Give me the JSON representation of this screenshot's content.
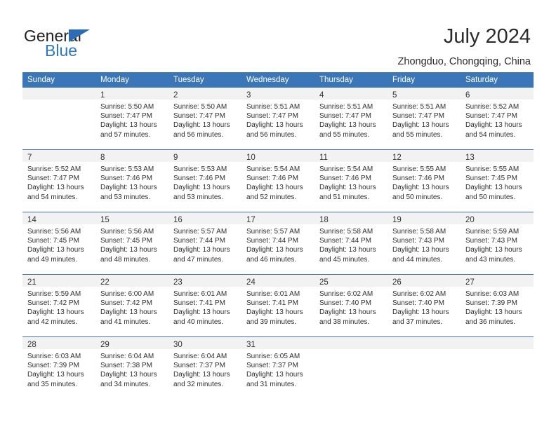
{
  "brand": {
    "name_part1": "General",
    "name_part2": "Blue",
    "triangle_color": "#2b6cb3",
    "blue_color": "#2b79c2"
  },
  "header": {
    "title": "July 2024",
    "subtitle": "Zhongduo, Chongqing, China",
    "accent_color": "#3a76b8"
  },
  "weekdays": [
    "Sunday",
    "Monday",
    "Tuesday",
    "Wednesday",
    "Thursday",
    "Friday",
    "Saturday"
  ],
  "labels": {
    "sunrise_prefix": "Sunrise: ",
    "sunset_prefix": "Sunset: ",
    "daylight_prefix": "Daylight: "
  },
  "weeks": [
    [
      {
        "day": "",
        "sunrise": "",
        "sunset": "",
        "daylight_line1": "",
        "daylight_line2": ""
      },
      {
        "day": "1",
        "sunrise": "Sunrise: 5:50 AM",
        "sunset": "Sunset: 7:47 PM",
        "daylight_line1": "Daylight: 13 hours",
        "daylight_line2": "and 57 minutes."
      },
      {
        "day": "2",
        "sunrise": "Sunrise: 5:50 AM",
        "sunset": "Sunset: 7:47 PM",
        "daylight_line1": "Daylight: 13 hours",
        "daylight_line2": "and 56 minutes."
      },
      {
        "day": "3",
        "sunrise": "Sunrise: 5:51 AM",
        "sunset": "Sunset: 7:47 PM",
        "daylight_line1": "Daylight: 13 hours",
        "daylight_line2": "and 56 minutes."
      },
      {
        "day": "4",
        "sunrise": "Sunrise: 5:51 AM",
        "sunset": "Sunset: 7:47 PM",
        "daylight_line1": "Daylight: 13 hours",
        "daylight_line2": "and 55 minutes."
      },
      {
        "day": "5",
        "sunrise": "Sunrise: 5:51 AM",
        "sunset": "Sunset: 7:47 PM",
        "daylight_line1": "Daylight: 13 hours",
        "daylight_line2": "and 55 minutes."
      },
      {
        "day": "6",
        "sunrise": "Sunrise: 5:52 AM",
        "sunset": "Sunset: 7:47 PM",
        "daylight_line1": "Daylight: 13 hours",
        "daylight_line2": "and 54 minutes."
      }
    ],
    [
      {
        "day": "7",
        "sunrise": "Sunrise: 5:52 AM",
        "sunset": "Sunset: 7:47 PM",
        "daylight_line1": "Daylight: 13 hours",
        "daylight_line2": "and 54 minutes."
      },
      {
        "day": "8",
        "sunrise": "Sunrise: 5:53 AM",
        "sunset": "Sunset: 7:46 PM",
        "daylight_line1": "Daylight: 13 hours",
        "daylight_line2": "and 53 minutes."
      },
      {
        "day": "9",
        "sunrise": "Sunrise: 5:53 AM",
        "sunset": "Sunset: 7:46 PM",
        "daylight_line1": "Daylight: 13 hours",
        "daylight_line2": "and 53 minutes."
      },
      {
        "day": "10",
        "sunrise": "Sunrise: 5:54 AM",
        "sunset": "Sunset: 7:46 PM",
        "daylight_line1": "Daylight: 13 hours",
        "daylight_line2": "and 52 minutes."
      },
      {
        "day": "11",
        "sunrise": "Sunrise: 5:54 AM",
        "sunset": "Sunset: 7:46 PM",
        "daylight_line1": "Daylight: 13 hours",
        "daylight_line2": "and 51 minutes."
      },
      {
        "day": "12",
        "sunrise": "Sunrise: 5:55 AM",
        "sunset": "Sunset: 7:46 PM",
        "daylight_line1": "Daylight: 13 hours",
        "daylight_line2": "and 50 minutes."
      },
      {
        "day": "13",
        "sunrise": "Sunrise: 5:55 AM",
        "sunset": "Sunset: 7:45 PM",
        "daylight_line1": "Daylight: 13 hours",
        "daylight_line2": "and 50 minutes."
      }
    ],
    [
      {
        "day": "14",
        "sunrise": "Sunrise: 5:56 AM",
        "sunset": "Sunset: 7:45 PM",
        "daylight_line1": "Daylight: 13 hours",
        "daylight_line2": "and 49 minutes."
      },
      {
        "day": "15",
        "sunrise": "Sunrise: 5:56 AM",
        "sunset": "Sunset: 7:45 PM",
        "daylight_line1": "Daylight: 13 hours",
        "daylight_line2": "and 48 minutes."
      },
      {
        "day": "16",
        "sunrise": "Sunrise: 5:57 AM",
        "sunset": "Sunset: 7:44 PM",
        "daylight_line1": "Daylight: 13 hours",
        "daylight_line2": "and 47 minutes."
      },
      {
        "day": "17",
        "sunrise": "Sunrise: 5:57 AM",
        "sunset": "Sunset: 7:44 PM",
        "daylight_line1": "Daylight: 13 hours",
        "daylight_line2": "and 46 minutes."
      },
      {
        "day": "18",
        "sunrise": "Sunrise: 5:58 AM",
        "sunset": "Sunset: 7:44 PM",
        "daylight_line1": "Daylight: 13 hours",
        "daylight_line2": "and 45 minutes."
      },
      {
        "day": "19",
        "sunrise": "Sunrise: 5:58 AM",
        "sunset": "Sunset: 7:43 PM",
        "daylight_line1": "Daylight: 13 hours",
        "daylight_line2": "and 44 minutes."
      },
      {
        "day": "20",
        "sunrise": "Sunrise: 5:59 AM",
        "sunset": "Sunset: 7:43 PM",
        "daylight_line1": "Daylight: 13 hours",
        "daylight_line2": "and 43 minutes."
      }
    ],
    [
      {
        "day": "21",
        "sunrise": "Sunrise: 5:59 AM",
        "sunset": "Sunset: 7:42 PM",
        "daylight_line1": "Daylight: 13 hours",
        "daylight_line2": "and 42 minutes."
      },
      {
        "day": "22",
        "sunrise": "Sunrise: 6:00 AM",
        "sunset": "Sunset: 7:42 PM",
        "daylight_line1": "Daylight: 13 hours",
        "daylight_line2": "and 41 minutes."
      },
      {
        "day": "23",
        "sunrise": "Sunrise: 6:01 AM",
        "sunset": "Sunset: 7:41 PM",
        "daylight_line1": "Daylight: 13 hours",
        "daylight_line2": "and 40 minutes."
      },
      {
        "day": "24",
        "sunrise": "Sunrise: 6:01 AM",
        "sunset": "Sunset: 7:41 PM",
        "daylight_line1": "Daylight: 13 hours",
        "daylight_line2": "and 39 minutes."
      },
      {
        "day": "25",
        "sunrise": "Sunrise: 6:02 AM",
        "sunset": "Sunset: 7:40 PM",
        "daylight_line1": "Daylight: 13 hours",
        "daylight_line2": "and 38 minutes."
      },
      {
        "day": "26",
        "sunrise": "Sunrise: 6:02 AM",
        "sunset": "Sunset: 7:40 PM",
        "daylight_line1": "Daylight: 13 hours",
        "daylight_line2": "and 37 minutes."
      },
      {
        "day": "27",
        "sunrise": "Sunrise: 6:03 AM",
        "sunset": "Sunset: 7:39 PM",
        "daylight_line1": "Daylight: 13 hours",
        "daylight_line2": "and 36 minutes."
      }
    ],
    [
      {
        "day": "28",
        "sunrise": "Sunrise: 6:03 AM",
        "sunset": "Sunset: 7:39 PM",
        "daylight_line1": "Daylight: 13 hours",
        "daylight_line2": "and 35 minutes."
      },
      {
        "day": "29",
        "sunrise": "Sunrise: 6:04 AM",
        "sunset": "Sunset: 7:38 PM",
        "daylight_line1": "Daylight: 13 hours",
        "daylight_line2": "and 34 minutes."
      },
      {
        "day": "30",
        "sunrise": "Sunrise: 6:04 AM",
        "sunset": "Sunset: 7:37 PM",
        "daylight_line1": "Daylight: 13 hours",
        "daylight_line2": "and 32 minutes."
      },
      {
        "day": "31",
        "sunrise": "Sunrise: 6:05 AM",
        "sunset": "Sunset: 7:37 PM",
        "daylight_line1": "Daylight: 13 hours",
        "daylight_line2": "and 31 minutes."
      },
      {
        "day": "",
        "sunrise": "",
        "sunset": "",
        "daylight_line1": "",
        "daylight_line2": ""
      },
      {
        "day": "",
        "sunrise": "",
        "sunset": "",
        "daylight_line1": "",
        "daylight_line2": ""
      },
      {
        "day": "",
        "sunrise": "",
        "sunset": "",
        "daylight_line1": "",
        "daylight_line2": ""
      }
    ]
  ]
}
